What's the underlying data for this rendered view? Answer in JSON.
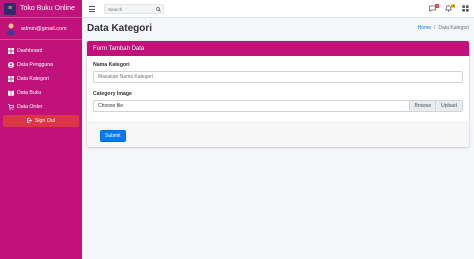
{
  "brand": {
    "title": "Toko Buku Online",
    "logo": "book-stack-logo"
  },
  "user": {
    "name": "admin@gmail.com",
    "avatar": "person-avatar-icon"
  },
  "nav": {
    "items": [
      {
        "label": "Dashboard",
        "icon": "table-grid-icon"
      },
      {
        "label": "Data Pengguna",
        "icon": "user-circle-icon"
      },
      {
        "label": "Data Kategori",
        "icon": "table-grid-icon"
      },
      {
        "label": "Data Buku",
        "icon": "book-icon"
      },
      {
        "label": "Data Order",
        "icon": "cart-icon"
      }
    ],
    "signout": "Sign Out"
  },
  "topbar": {
    "search_placeholder": "Search",
    "notif_badge_left": "3",
    "notif_badge_right": "15"
  },
  "header": {
    "title": "Data Kategori",
    "breadcrumb_home": "Home",
    "breadcrumb_sep": "/",
    "breadcrumb_current": "Data Kategori"
  },
  "form": {
    "title": "Form Tambah Data",
    "kategori_label": "Nama Kategori",
    "kategori_placeholder": "Masukan Nama Kategori",
    "image_label": "Category Image",
    "file_text": "Choose file",
    "browse_label": "Browse",
    "upload_label": "Upload",
    "submit_label": "Submit"
  },
  "colors": {
    "primary": "#c0127a",
    "accent": "#007bff",
    "danger": "#dc3545"
  }
}
